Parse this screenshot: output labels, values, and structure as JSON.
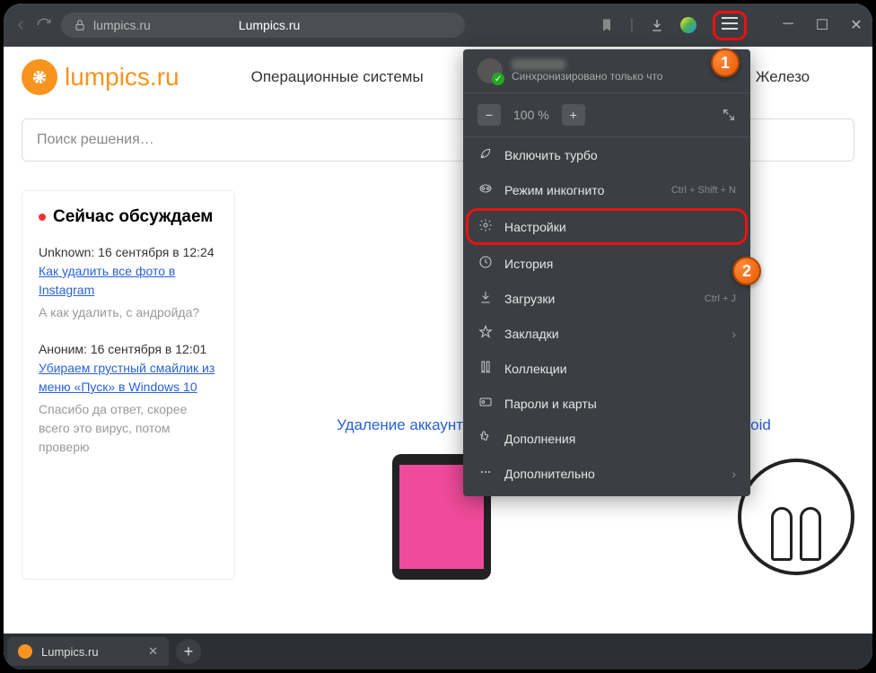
{
  "browser": {
    "url": "lumpics.ru",
    "page_title": "Lumpics.ru",
    "tab_label": "Lumpics.ru",
    "zoom": "100 %"
  },
  "site": {
    "logo": "lumpics.ru",
    "nav": [
      "Операционные системы",
      "Железо"
    ],
    "search_placeholder": "Поиск решения…"
  },
  "sidebar": {
    "title": "Сейчас обсуждаем",
    "comments": [
      {
        "author": "Unknown:",
        "meta": "16 сентября в 12:24",
        "link": "Как удалить все фото в Instagram",
        "body": "А как удалить, с андройда?"
      },
      {
        "author": "Аноним:",
        "meta": "16 сентября в 12:01",
        "link": "Убираем грустный смайлик из меню «Пуск» в Windows 10",
        "body": "Спасибо да ответ, скорее всего это вирус, потом проверю"
      }
    ]
  },
  "article": {
    "title": "Удаление аккаунта Google на iPhone и смартфонах с Android"
  },
  "menu": {
    "sync_status": "Синхронизировано только что",
    "items": [
      {
        "icon": "rocket",
        "label": "Включить турбо",
        "shortcut": ""
      },
      {
        "icon": "mask",
        "label": "Режим инкогнито",
        "shortcut": "Ctrl + Shift + N"
      },
      {
        "icon": "gear",
        "label": "Настройки",
        "shortcut": "",
        "highlighted": true
      },
      {
        "icon": "clock",
        "label": "История",
        "shortcut": ""
      },
      {
        "icon": "download",
        "label": "Загрузки",
        "shortcut": "Ctrl + J"
      },
      {
        "icon": "star",
        "label": "Закладки",
        "shortcut": "",
        "arrow": true
      },
      {
        "icon": "bookmark",
        "label": "Коллекции",
        "shortcut": ""
      },
      {
        "icon": "key",
        "label": "Пароли и карты",
        "shortcut": ""
      },
      {
        "icon": "puzzle",
        "label": "Дополнения",
        "shortcut": ""
      },
      {
        "icon": "dots",
        "label": "Дополнительно",
        "shortcut": "",
        "arrow": true
      }
    ]
  },
  "badges": {
    "one": "1",
    "two": "2"
  }
}
